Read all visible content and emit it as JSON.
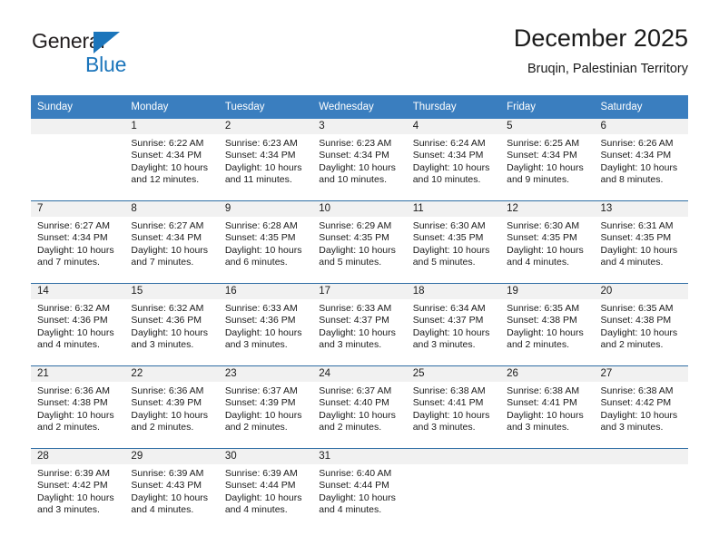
{
  "brand": {
    "name_part1": "General",
    "name_part2": "Blue",
    "triangle_color": "#1b75bb"
  },
  "header": {
    "title": "December 2025",
    "subtitle": "Bruqin, Palestinian Territory"
  },
  "theme": {
    "header_blue": "#3a7ebf",
    "separator_blue": "#2e6da4",
    "daynum_band": "#f1f1f1"
  },
  "weekday_headers": [
    "Sunday",
    "Monday",
    "Tuesday",
    "Wednesday",
    "Thursday",
    "Friday",
    "Saturday"
  ],
  "weeks": [
    {
      "days": [
        {
          "num": "",
          "sunrise": "",
          "sunset": "",
          "daylight_line1": "",
          "daylight_line2": ""
        },
        {
          "num": "1",
          "sunrise": "Sunrise: 6:22 AM",
          "sunset": "Sunset: 4:34 PM",
          "daylight_line1": "Daylight: 10 hours",
          "daylight_line2": "and 12 minutes."
        },
        {
          "num": "2",
          "sunrise": "Sunrise: 6:23 AM",
          "sunset": "Sunset: 4:34 PM",
          "daylight_line1": "Daylight: 10 hours",
          "daylight_line2": "and 11 minutes."
        },
        {
          "num": "3",
          "sunrise": "Sunrise: 6:23 AM",
          "sunset": "Sunset: 4:34 PM",
          "daylight_line1": "Daylight: 10 hours",
          "daylight_line2": "and 10 minutes."
        },
        {
          "num": "4",
          "sunrise": "Sunrise: 6:24 AM",
          "sunset": "Sunset: 4:34 PM",
          "daylight_line1": "Daylight: 10 hours",
          "daylight_line2": "and 10 minutes."
        },
        {
          "num": "5",
          "sunrise": "Sunrise: 6:25 AM",
          "sunset": "Sunset: 4:34 PM",
          "daylight_line1": "Daylight: 10 hours",
          "daylight_line2": "and 9 minutes."
        },
        {
          "num": "6",
          "sunrise": "Sunrise: 6:26 AM",
          "sunset": "Sunset: 4:34 PM",
          "daylight_line1": "Daylight: 10 hours",
          "daylight_line2": "and 8 minutes."
        }
      ]
    },
    {
      "days": [
        {
          "num": "7",
          "sunrise": "Sunrise: 6:27 AM",
          "sunset": "Sunset: 4:34 PM",
          "daylight_line1": "Daylight: 10 hours",
          "daylight_line2": "and 7 minutes."
        },
        {
          "num": "8",
          "sunrise": "Sunrise: 6:27 AM",
          "sunset": "Sunset: 4:34 PM",
          "daylight_line1": "Daylight: 10 hours",
          "daylight_line2": "and 7 minutes."
        },
        {
          "num": "9",
          "sunrise": "Sunrise: 6:28 AM",
          "sunset": "Sunset: 4:35 PM",
          "daylight_line1": "Daylight: 10 hours",
          "daylight_line2": "and 6 minutes."
        },
        {
          "num": "10",
          "sunrise": "Sunrise: 6:29 AM",
          "sunset": "Sunset: 4:35 PM",
          "daylight_line1": "Daylight: 10 hours",
          "daylight_line2": "and 5 minutes."
        },
        {
          "num": "11",
          "sunrise": "Sunrise: 6:30 AM",
          "sunset": "Sunset: 4:35 PM",
          "daylight_line1": "Daylight: 10 hours",
          "daylight_line2": "and 5 minutes."
        },
        {
          "num": "12",
          "sunrise": "Sunrise: 6:30 AM",
          "sunset": "Sunset: 4:35 PM",
          "daylight_line1": "Daylight: 10 hours",
          "daylight_line2": "and 4 minutes."
        },
        {
          "num": "13",
          "sunrise": "Sunrise: 6:31 AM",
          "sunset": "Sunset: 4:35 PM",
          "daylight_line1": "Daylight: 10 hours",
          "daylight_line2": "and 4 minutes."
        }
      ]
    },
    {
      "days": [
        {
          "num": "14",
          "sunrise": "Sunrise: 6:32 AM",
          "sunset": "Sunset: 4:36 PM",
          "daylight_line1": "Daylight: 10 hours",
          "daylight_line2": "and 4 minutes."
        },
        {
          "num": "15",
          "sunrise": "Sunrise: 6:32 AM",
          "sunset": "Sunset: 4:36 PM",
          "daylight_line1": "Daylight: 10 hours",
          "daylight_line2": "and 3 minutes."
        },
        {
          "num": "16",
          "sunrise": "Sunrise: 6:33 AM",
          "sunset": "Sunset: 4:36 PM",
          "daylight_line1": "Daylight: 10 hours",
          "daylight_line2": "and 3 minutes."
        },
        {
          "num": "17",
          "sunrise": "Sunrise: 6:33 AM",
          "sunset": "Sunset: 4:37 PM",
          "daylight_line1": "Daylight: 10 hours",
          "daylight_line2": "and 3 minutes."
        },
        {
          "num": "18",
          "sunrise": "Sunrise: 6:34 AM",
          "sunset": "Sunset: 4:37 PM",
          "daylight_line1": "Daylight: 10 hours",
          "daylight_line2": "and 3 minutes."
        },
        {
          "num": "19",
          "sunrise": "Sunrise: 6:35 AM",
          "sunset": "Sunset: 4:38 PM",
          "daylight_line1": "Daylight: 10 hours",
          "daylight_line2": "and 2 minutes."
        },
        {
          "num": "20",
          "sunrise": "Sunrise: 6:35 AM",
          "sunset": "Sunset: 4:38 PM",
          "daylight_line1": "Daylight: 10 hours",
          "daylight_line2": "and 2 minutes."
        }
      ]
    },
    {
      "days": [
        {
          "num": "21",
          "sunrise": "Sunrise: 6:36 AM",
          "sunset": "Sunset: 4:38 PM",
          "daylight_line1": "Daylight: 10 hours",
          "daylight_line2": "and 2 minutes."
        },
        {
          "num": "22",
          "sunrise": "Sunrise: 6:36 AM",
          "sunset": "Sunset: 4:39 PM",
          "daylight_line1": "Daylight: 10 hours",
          "daylight_line2": "and 2 minutes."
        },
        {
          "num": "23",
          "sunrise": "Sunrise: 6:37 AM",
          "sunset": "Sunset: 4:39 PM",
          "daylight_line1": "Daylight: 10 hours",
          "daylight_line2": "and 2 minutes."
        },
        {
          "num": "24",
          "sunrise": "Sunrise: 6:37 AM",
          "sunset": "Sunset: 4:40 PM",
          "daylight_line1": "Daylight: 10 hours",
          "daylight_line2": "and 2 minutes."
        },
        {
          "num": "25",
          "sunrise": "Sunrise: 6:38 AM",
          "sunset": "Sunset: 4:41 PM",
          "daylight_line1": "Daylight: 10 hours",
          "daylight_line2": "and 3 minutes."
        },
        {
          "num": "26",
          "sunrise": "Sunrise: 6:38 AM",
          "sunset": "Sunset: 4:41 PM",
          "daylight_line1": "Daylight: 10 hours",
          "daylight_line2": "and 3 minutes."
        },
        {
          "num": "27",
          "sunrise": "Sunrise: 6:38 AM",
          "sunset": "Sunset: 4:42 PM",
          "daylight_line1": "Daylight: 10 hours",
          "daylight_line2": "and 3 minutes."
        }
      ]
    },
    {
      "days": [
        {
          "num": "28",
          "sunrise": "Sunrise: 6:39 AM",
          "sunset": "Sunset: 4:42 PM",
          "daylight_line1": "Daylight: 10 hours",
          "daylight_line2": "and 3 minutes."
        },
        {
          "num": "29",
          "sunrise": "Sunrise: 6:39 AM",
          "sunset": "Sunset: 4:43 PM",
          "daylight_line1": "Daylight: 10 hours",
          "daylight_line2": "and 4 minutes."
        },
        {
          "num": "30",
          "sunrise": "Sunrise: 6:39 AM",
          "sunset": "Sunset: 4:44 PM",
          "daylight_line1": "Daylight: 10 hours",
          "daylight_line2": "and 4 minutes."
        },
        {
          "num": "31",
          "sunrise": "Sunrise: 6:40 AM",
          "sunset": "Sunset: 4:44 PM",
          "daylight_line1": "Daylight: 10 hours",
          "daylight_line2": "and 4 minutes."
        },
        {
          "num": "",
          "sunrise": "",
          "sunset": "",
          "daylight_line1": "",
          "daylight_line2": ""
        },
        {
          "num": "",
          "sunrise": "",
          "sunset": "",
          "daylight_line1": "",
          "daylight_line2": ""
        },
        {
          "num": "",
          "sunrise": "",
          "sunset": "",
          "daylight_line1": "",
          "daylight_line2": ""
        }
      ]
    }
  ]
}
